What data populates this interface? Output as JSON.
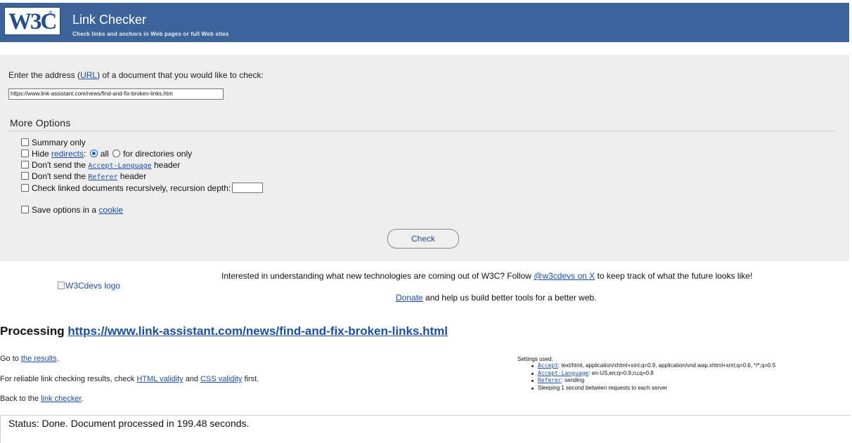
{
  "banner": {
    "logo_text": "W3C",
    "logo_reg": "®",
    "title": "Link Checker",
    "subtitle": "Check links and anchors in Web pages or full Web sites"
  },
  "form": {
    "address_prefix": "Enter the address (",
    "address_link": "URL",
    "address_suffix": ") of a document that you would like to check:",
    "uri_value": "https://www.link-assistant.com/news/find-and-fix-broken-links.htm",
    "more_options_title": "More Options",
    "options": {
      "summary_only": "Summary only",
      "hide_prefix": "Hide ",
      "hide_link": "redirects",
      "hide_colon": ":",
      "radio_all": "all",
      "radio_dirs": "for directories only",
      "no_accept_lang_prefix": "Don't send the ",
      "no_accept_lang_code": "Accept-Language",
      "no_accept_lang_suffix": " header",
      "no_referer_prefix": "Don't send the ",
      "no_referer_code": "Referer",
      "no_referer_suffix": " header",
      "recursive": "Check linked documents recursively, recursion depth:",
      "save_prefix": "Save options in a ",
      "save_link": "cookie"
    },
    "check_button": "Check"
  },
  "promo": {
    "logo_alt": "W3Cdevs logo",
    "text_prefix": "Interested in understanding what new technologies are coming out of W3C? Follow ",
    "text_link": "@w3cdevs on X",
    "text_suffix": " to keep track of what the future looks like!",
    "donate_link": "Donate",
    "donate_suffix": " and help us build better tools for a better web."
  },
  "processing": {
    "heading_prefix": "Processing ",
    "heading_url": "https://www.link-assistant.com/news/find-and-fix-broken-links.html",
    "goto_prefix": "Go to ",
    "goto_link": "the results",
    "goto_suffix": ".",
    "reliable_prefix": "For reliable link checking results, check ",
    "html_validity_link": "HTML validity",
    "reliable_and": " and ",
    "css_validity_link": "CSS validity",
    "reliable_suffix": " first.",
    "back_prefix": "Back to the ",
    "back_link": "link checker",
    "back_suffix": "."
  },
  "settings": {
    "title": "Settings used:",
    "items": [
      {
        "code": "Accept",
        "value": ": text/html, application/xhtml+xml;q=0.9, application/vnd.wap.xhtml+xml;q=0.6, */*;q=0.5"
      },
      {
        "code": "Accept-Language",
        "value": ": en-US,en;q=0.9,ru;q=0.8"
      },
      {
        "code": "Referer",
        "value": ": sending"
      },
      {
        "code": "",
        "value": "Sleeping 1 second between requests to each server"
      }
    ]
  },
  "status": {
    "text": "Status: Done. Document processed in 199.48 seconds."
  }
}
